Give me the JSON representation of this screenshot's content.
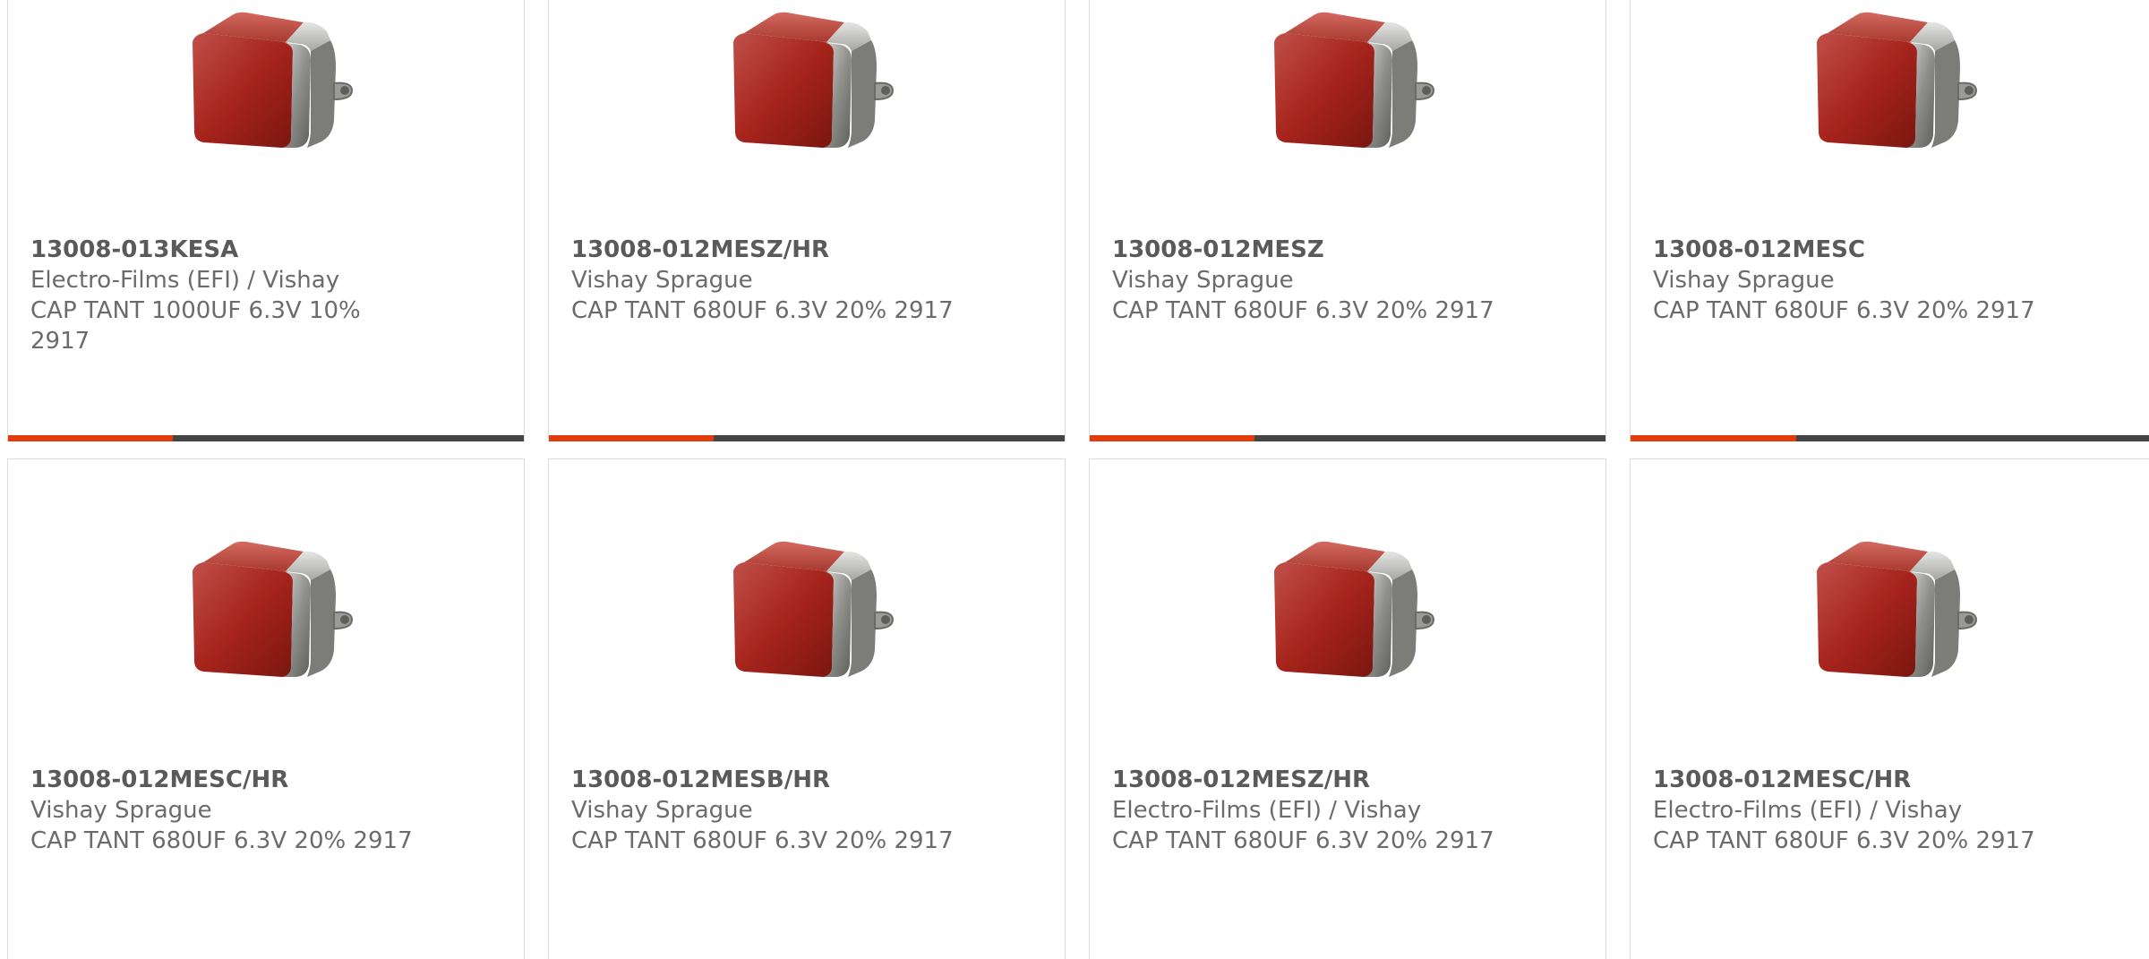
{
  "accent_color": "#e23c0c",
  "bar_track_color": "#444444",
  "products": [
    {
      "part": "13008-013KESA",
      "manufacturer": "Electro-Films (EFI) / Vishay",
      "description": "CAP TANT 1000UF 6.3V 10% 2917",
      "image_icon": "tantalum-capacitor-image",
      "progress": 0.32
    },
    {
      "part": "13008-012MESZ/HR",
      "manufacturer": "Vishay Sprague",
      "description": "CAP TANT 680UF 6.3V 20% 2917",
      "image_icon": "tantalum-capacitor-image",
      "progress": 0.32
    },
    {
      "part": "13008-012MESZ",
      "manufacturer": "Vishay Sprague",
      "description": "CAP TANT 680UF 6.3V 20% 2917",
      "image_icon": "tantalum-capacitor-image",
      "progress": 0.32
    },
    {
      "part": "13008-012MESC",
      "manufacturer": "Vishay Sprague",
      "description": "CAP TANT 680UF 6.3V 20% 2917",
      "image_icon": "tantalum-capacitor-image",
      "progress": 0.32
    },
    {
      "part": "13008-012MESC/HR",
      "manufacturer": "Vishay Sprague",
      "description": "CAP TANT 680UF 6.3V 20% 2917",
      "image_icon": "tantalum-capacitor-image"
    },
    {
      "part": "13008-012MESB/HR",
      "manufacturer": "Vishay Sprague",
      "description": "CAP TANT 680UF 6.3V 20% 2917",
      "image_icon": "tantalum-capacitor-image"
    },
    {
      "part": "13008-012MESZ/HR",
      "manufacturer": "Electro-Films (EFI) / Vishay",
      "description": "CAP TANT 680UF 6.3V 20% 2917",
      "image_icon": "tantalum-capacitor-image"
    },
    {
      "part": "13008-012MESC/HR",
      "manufacturer": "Electro-Films (EFI) / Vishay",
      "description": "CAP TANT 680UF 6.3V 20% 2917",
      "image_icon": "tantalum-capacitor-image"
    }
  ]
}
